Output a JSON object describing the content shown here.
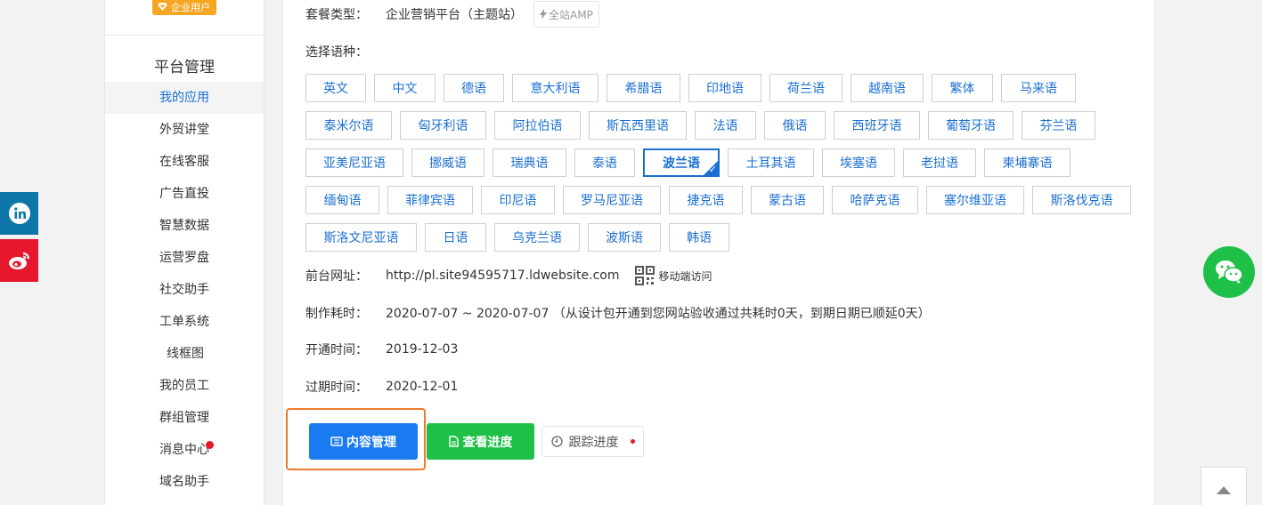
{
  "social": {
    "linkedin_icon": "linkedin-icon",
    "weibo_icon": "weibo-icon"
  },
  "sidebar": {
    "badge": "企业用户",
    "section_title": "平台管理",
    "items": [
      {
        "label": "我的应用",
        "active": true
      },
      {
        "label": "外贸讲堂"
      },
      {
        "label": "在线客服"
      },
      {
        "label": "广告直投"
      },
      {
        "label": "智慧数据"
      },
      {
        "label": "运营罗盘"
      },
      {
        "label": "社交助手"
      },
      {
        "label": "工单系统"
      },
      {
        "label": "线框图"
      },
      {
        "label": "我的员工"
      },
      {
        "label": "群组管理"
      },
      {
        "label": "消息中心",
        "notification_dot": true
      },
      {
        "label": "域名助手"
      }
    ]
  },
  "main": {
    "package": {
      "label": "套餐类型：",
      "value": "企业营销平台（主题站）",
      "tag": "全站AMP"
    },
    "languages": {
      "label": "选择语种：",
      "selected": "波兰语",
      "rows": [
        [
          "英文",
          "中文",
          "德语",
          "意大利语",
          "希腊语",
          "印地语",
          "荷兰语",
          "越南语",
          "繁体",
          "马来语"
        ],
        [
          "泰米尔语",
          "匈牙利语",
          "阿拉伯语",
          "斯瓦西里语",
          "法语",
          "俄语",
          "西班牙语",
          "葡萄牙语",
          "芬兰语"
        ],
        [
          "亚美尼亚语",
          "挪威语",
          "瑞典语",
          "泰语",
          "波兰语",
          "土耳其语",
          "埃塞语",
          "老挝语",
          "柬埔寨语"
        ],
        [
          "缅甸语",
          "菲律宾语",
          "印尼语",
          "罗马尼亚语",
          "捷克语",
          "蒙古语",
          "哈萨克语",
          "塞尔维亚语",
          "斯洛伐克语"
        ],
        [
          "斯洛文尼亚语",
          "日语",
          "乌克兰语",
          "波斯语",
          "韩语"
        ]
      ]
    },
    "site_url": {
      "label": "前台网址：",
      "value": "http://pl.site94595717.ldwebsite.com",
      "mobile_label": "移动端访问"
    },
    "build_time": {
      "label": "制作耗时：",
      "value": "2020-07-07 ~ 2020-07-07 （从设计包开通到您网站验收通过共耗时0天，到期日期已顺延0天）"
    },
    "open_time": {
      "label": "开通时间：",
      "value": "2019-12-03"
    },
    "expire_time": {
      "label": "过期时间：",
      "value": "2020-12-01"
    },
    "buttons": {
      "content": "内容管理",
      "progress": "查看进度",
      "track": "跟踪进度"
    },
    "colors": {
      "primary": "#1a7af0",
      "success": "#1ec047",
      "highlight": "#f07a2c"
    }
  }
}
